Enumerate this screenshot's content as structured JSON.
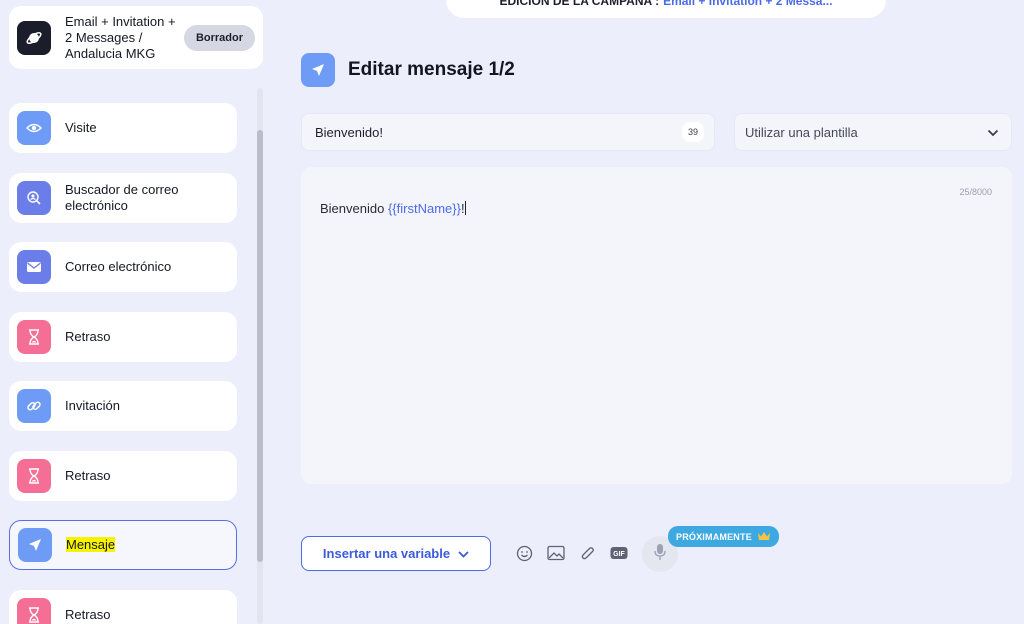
{
  "campaign": {
    "name": "Email + Invitation + 2 Messages / Andalucia MKG",
    "status": "Borrador"
  },
  "steps": [
    {
      "label": "Visite",
      "icon": "eye-icon",
      "color": "#6e9bf5"
    },
    {
      "label": "Buscador de correo electrónico",
      "icon": "email-finder-icon",
      "color": "#6b7de8"
    },
    {
      "label": "Correo electrónico",
      "icon": "envelope-icon",
      "color": "#6b7de8"
    },
    {
      "label": "Retraso",
      "icon": "hourglass-icon",
      "color": "#f46e96"
    },
    {
      "label": "Invitación",
      "icon": "link-icon",
      "color": "#6e9bf5"
    },
    {
      "label": "Retraso",
      "icon": "hourglass-icon",
      "color": "#f46e96"
    },
    {
      "label": "Mensaje",
      "icon": "send-icon",
      "color": "#6e9bf5",
      "active": true
    },
    {
      "label": "Retraso",
      "icon": "hourglass-icon",
      "color": "#f46e96"
    }
  ],
  "banner": {
    "label": "EDICIÓN DE LA CAMPAÑA :",
    "value": "Email + Invitation + 2 Messa..."
  },
  "editor": {
    "title": "Editar mensaje 1/2",
    "subject_value": "Bienvenido!",
    "subject_count": "39",
    "template_placeholder": "Utilizar una plantilla",
    "counter": "25/8000",
    "body_text": "Bienvenido ",
    "body_variable": "{{firstName}}",
    "body_suffix": "!"
  },
  "toolbar": {
    "insert_variable_label": "Insertar una variable",
    "gif_label": "GIF",
    "soon_label": "PRÓXIMAMENTE"
  },
  "colors": {
    "accent": "#4b6ae6",
    "background": "#eceefb",
    "highlight": "#f7f200"
  }
}
